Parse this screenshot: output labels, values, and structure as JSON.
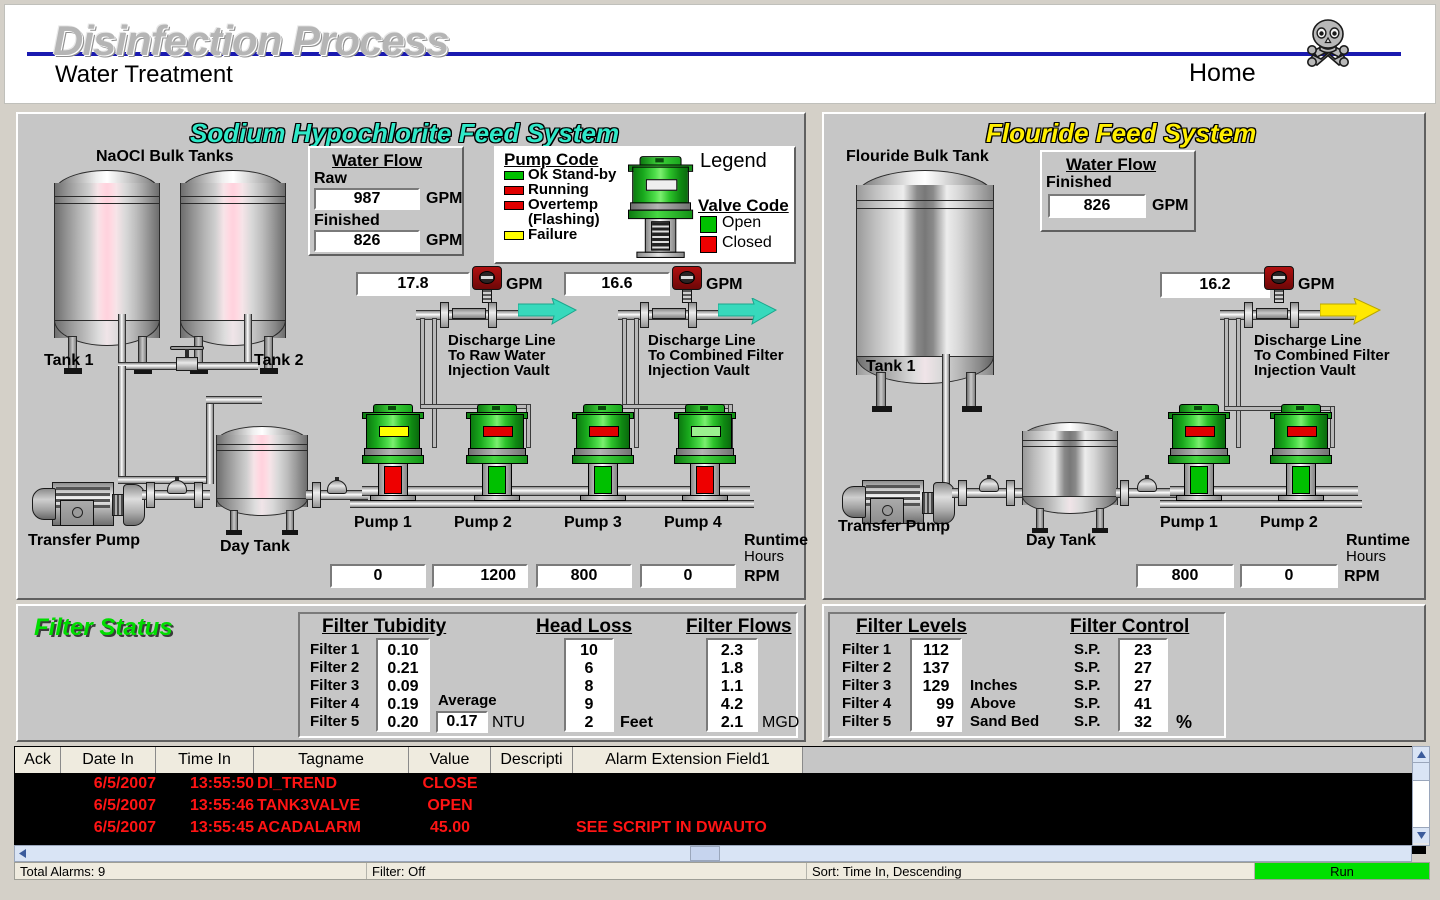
{
  "header": {
    "title": "Disinfection Process",
    "subtitle": "Water Treatment",
    "home_link": "Home",
    "hazard_icon": "skull-and-crossbones-icon",
    "accent_line_color": "#1a1ab0"
  },
  "hypo_panel": {
    "title": "Sodium Hypochlorite Feed System",
    "title_color": "#2fe8c8",
    "bulk_tanks_label": "NaOCl Bulk Tanks",
    "tank1_label": "Tank 1",
    "tank2_label": "Tank 2",
    "transfer_pump_label": "Transfer Pump",
    "day_tank_label": "Day Tank",
    "water_flow": {
      "heading": "Water Flow",
      "raw_label": "Raw",
      "raw_value": "987",
      "raw_units": "GPM",
      "finished_label": "Finished",
      "finished_value": "826",
      "finished_units": "GPM"
    },
    "legend": {
      "title": "Legend",
      "pump_code_heading": "Pump Code",
      "pump_codes": [
        {
          "label": "Ok Stand-by",
          "color": "#00c000"
        },
        {
          "label": "Running",
          "color": "#e00000"
        },
        {
          "label": "Overtemp",
          "color": "#e00000"
        },
        {
          "label": "(Flashing)",
          "color": ""
        },
        {
          "label": "Failure",
          "color": "#ffff00"
        }
      ],
      "valve_code_heading": "Valve Code",
      "valve_codes": [
        {
          "label": "Open",
          "color": "#00c000"
        },
        {
          "label": "Closed",
          "color": "#ee0000"
        }
      ]
    },
    "discharge_1": {
      "value": "17.8",
      "units": "GPM",
      "line1": "Discharge Line",
      "line2": "To Raw Water",
      "line3": "Injection Vault",
      "arrow_color": "#37d9bc"
    },
    "discharge_2": {
      "value": "16.6",
      "units": "GPM",
      "line1": "Discharge Line",
      "line2": "To Combined Filter",
      "line3": "Injection Vault",
      "arrow_color": "#37d9bc"
    },
    "pumps": [
      {
        "name": "Pump 1",
        "status_color": "#ffff00",
        "valve_color": "#ee0000",
        "rpm": "0"
      },
      {
        "name": "Pump 2",
        "status_color": "#e00000",
        "valve_color": "#00c000",
        "rpm": "1200"
      },
      {
        "name": "Pump 3",
        "status_color": "#e00000",
        "valve_color": "#00c000",
        "rpm": "800"
      },
      {
        "name": "Pump 4",
        "status_color": "#9bf08f",
        "valve_color": "#ee0000",
        "rpm": "0"
      }
    ],
    "runtime_label_1": "Runtime",
    "runtime_label_2": "Hours",
    "rpm_units": "RPM"
  },
  "fluoride_panel": {
    "title": "Flouride Feed System",
    "title_color": "#ffee00",
    "bulk_tank_label": "Flouride Bulk Tank",
    "tank1_label": "Tank 1",
    "transfer_pump_label": "Transfer Pump",
    "day_tank_label": "Day Tank",
    "water_flow": {
      "heading": "Water Flow",
      "finished_label": "Finished",
      "finished_value": "826",
      "finished_units": "GPM"
    },
    "discharge": {
      "value": "16.2",
      "units": "GPM",
      "line1": "Discharge Line",
      "line2": "To Combined Filter",
      "line3": "Injection Vault",
      "arrow_color": "#ffe800"
    },
    "pumps": [
      {
        "name": "Pump 1",
        "status_color": "#e00000",
        "valve_color": "#00c000",
        "rpm": "800"
      },
      {
        "name": "Pump 2",
        "status_color": "#e00000",
        "valve_color": "#00c000",
        "rpm": "0"
      }
    ],
    "runtime_label_1": "Runtime",
    "runtime_label_2": "Hours",
    "rpm_units": "RPM"
  },
  "filter_status": {
    "title": "Filter Status",
    "title_color": "#00dd00",
    "row_labels": [
      "Filter 1",
      "Filter 2",
      "Filter 3",
      "Filter 4",
      "Filter 5"
    ],
    "turbidity": {
      "heading": "Filter Tubidity",
      "values": [
        "0.10",
        "0.21",
        "0.09",
        "0.19",
        "0.20"
      ],
      "average_label": "Average",
      "average_value": "0.17",
      "units": "NTU"
    },
    "head_loss": {
      "heading": "Head Loss",
      "values": [
        "10",
        "6",
        "8",
        "9",
        "2"
      ],
      "units": "Feet"
    },
    "filter_flows": {
      "heading": "Filter Flows",
      "values": [
        "2.3",
        "1.8",
        "1.1",
        "4.2",
        "2.1"
      ],
      "units": "MGD"
    },
    "filter_levels": {
      "heading": "Filter Levels",
      "values": [
        "112",
        "137",
        "129",
        "99",
        "97"
      ],
      "units_line1": "Inches",
      "units_line2": "Above",
      "units_line3": "Sand Bed"
    },
    "filter_control": {
      "heading": "Filter Control",
      "sp_label": "S.P.",
      "values": [
        "23",
        "27",
        "27",
        "41",
        "32"
      ],
      "units": "%"
    }
  },
  "alarm_table": {
    "columns": [
      "Ack",
      "Date In",
      "Time In",
      "Tagname",
      "Value",
      "Descripti",
      "Alarm Extension Field1"
    ],
    "rows": [
      {
        "ack": "",
        "date_in": "6/5/2007",
        "time_in": "13:55:50",
        "tagname": "DI_TREND",
        "value": "CLOSE",
        "description": "",
        "ext_field1": ""
      },
      {
        "ack": "",
        "date_in": "6/5/2007",
        "time_in": "13:55:46",
        "tagname": "TANK3VALVE",
        "value": "OPEN",
        "description": "",
        "ext_field1": ""
      },
      {
        "ack": "",
        "date_in": "6/5/2007",
        "time_in": "13:55:45",
        "tagname": "ACADALARM",
        "value": "45.00",
        "description": "",
        "ext_field1": "SEE SCRIPT IN DWAUTO"
      }
    ],
    "text_color": "#ff1414"
  },
  "statusbar": {
    "total_alarms": "Total Alarms: 9",
    "filter_state": "Filter: Off",
    "sort_state": "Sort: Time In, Descending",
    "run_state": "Run",
    "run_color": "#00e000"
  }
}
